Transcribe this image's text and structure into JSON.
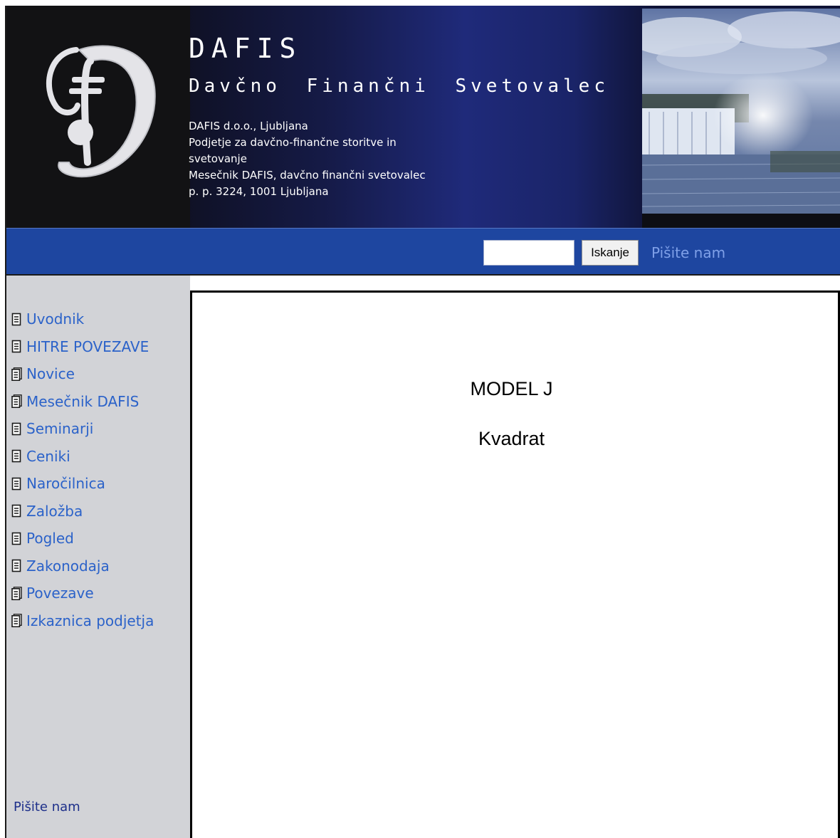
{
  "header": {
    "title": "DAFIS",
    "subtitle": "Davčno Finančni Svetovalec",
    "company_lines": [
      "DAFIS d.o.o., Ljubljana",
      "Podjetje za davčno-finančne storitve in",
      "svetovanje",
      "Mesečnik DAFIS, davčno finančni svetovalec",
      "p. p. 3224, 1001 Ljubljana"
    ]
  },
  "searchbar": {
    "input_value": "",
    "button_label": "Iskanje",
    "write_us": "Pišite nam"
  },
  "sidebar": {
    "items": [
      {
        "label": "Uvodnik",
        "icon": "document-icon"
      },
      {
        "label": "HITRE POVEZAVE",
        "icon": "document-icon"
      },
      {
        "label": "Novice",
        "icon": "document-stack-icon"
      },
      {
        "label": "Mesečnik DAFIS",
        "icon": "document-stack-icon"
      },
      {
        "label": "Seminarji",
        "icon": "document-icon"
      },
      {
        "label": "Ceniki",
        "icon": "document-icon"
      },
      {
        "label": "Naročilnica",
        "icon": "document-icon"
      },
      {
        "label": "Založba",
        "icon": "document-icon"
      },
      {
        "label": "Pogled",
        "icon": "document-icon"
      },
      {
        "label": "Zakonodaja",
        "icon": "document-icon"
      },
      {
        "label": "Povezave",
        "icon": "document-stack-icon"
      },
      {
        "label": "Izkaznica podjetja",
        "icon": "document-stack-icon"
      }
    ],
    "write_us": "Pišite nam"
  },
  "content": {
    "title": "MODEL J",
    "subtitle": "Kvadrat"
  },
  "colors": {
    "header_dark": "#121214",
    "header_blue": "#1f2a7a",
    "searchbar_blue": "#1e46a0",
    "sidebar_bg": "#d2d3d7",
    "link_blue": "#2b62c9"
  }
}
